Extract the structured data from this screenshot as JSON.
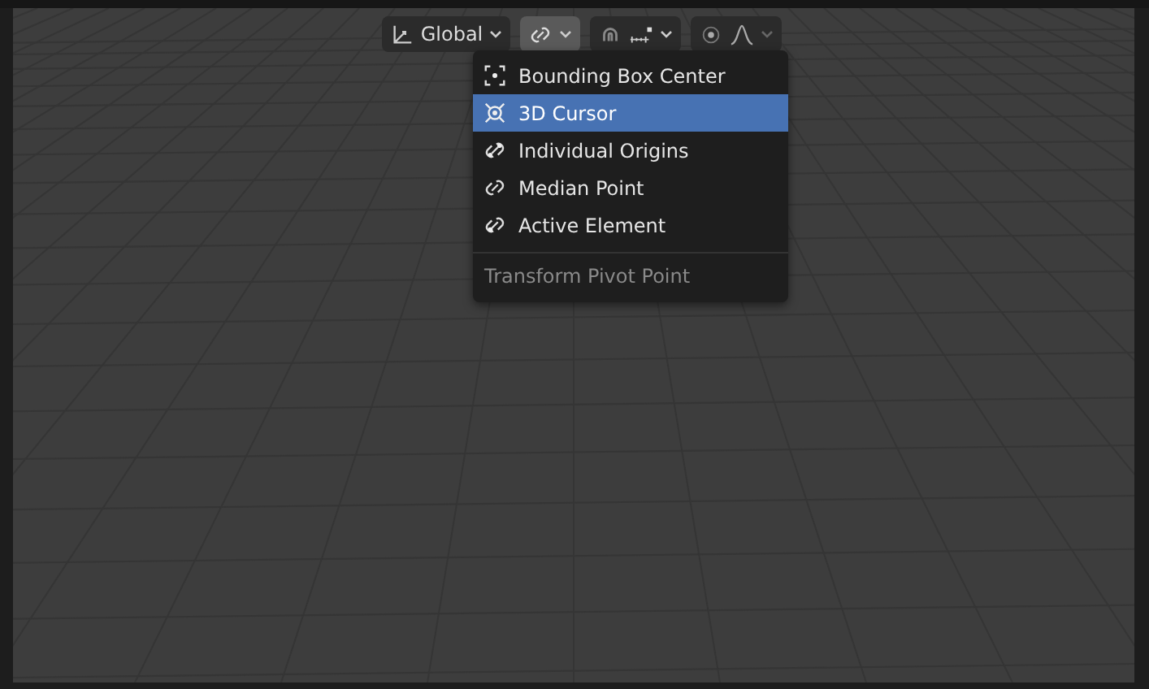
{
  "header": {
    "orientation": {
      "label": "Global"
    },
    "pivot_button": {
      "expanded": true
    },
    "snap_button": {
      "on": false
    },
    "proportional_button": {
      "on": false
    }
  },
  "pivot_menu": {
    "items": [
      {
        "kind": "bbox",
        "label": "Bounding Box Center",
        "selected": false
      },
      {
        "kind": "cursor",
        "label": "3D Cursor",
        "selected": true
      },
      {
        "kind": "individual",
        "label": "Individual Origins",
        "selected": false
      },
      {
        "kind": "median",
        "label": "Median Point",
        "selected": false
      },
      {
        "kind": "active",
        "label": "Active Element",
        "selected": false
      }
    ],
    "footer": "Transform Pivot Point"
  }
}
